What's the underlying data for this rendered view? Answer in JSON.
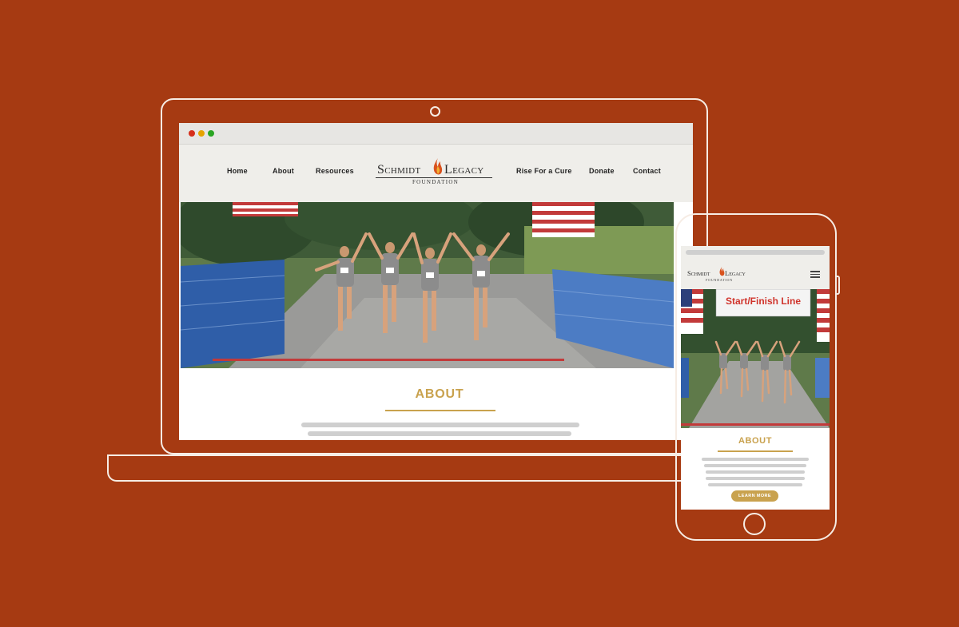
{
  "colors": {
    "background": "#a63a12",
    "device_outline": "#f6ece4",
    "accent_gold": "#c9a24e",
    "header_bg": "#efeeea"
  },
  "desktop": {
    "nav": {
      "items": [
        "Home",
        "About",
        "Resources",
        "Rise For a Cure",
        "Donate",
        "Contact"
      ]
    },
    "logo": {
      "word_left": "Schmidt",
      "word_right": "Legacy",
      "subtitle": "FOUNDATION",
      "icon": "flame-icon"
    },
    "about": {
      "title": "ABOUT"
    }
  },
  "mobile": {
    "logo": {
      "word_left": "Schmidt",
      "word_right": "Legacy",
      "subtitle": "FOUNDATION"
    },
    "banner_text": "Start/Finish Line",
    "about": {
      "title": "ABOUT",
      "button": "LEARN MORE"
    }
  }
}
